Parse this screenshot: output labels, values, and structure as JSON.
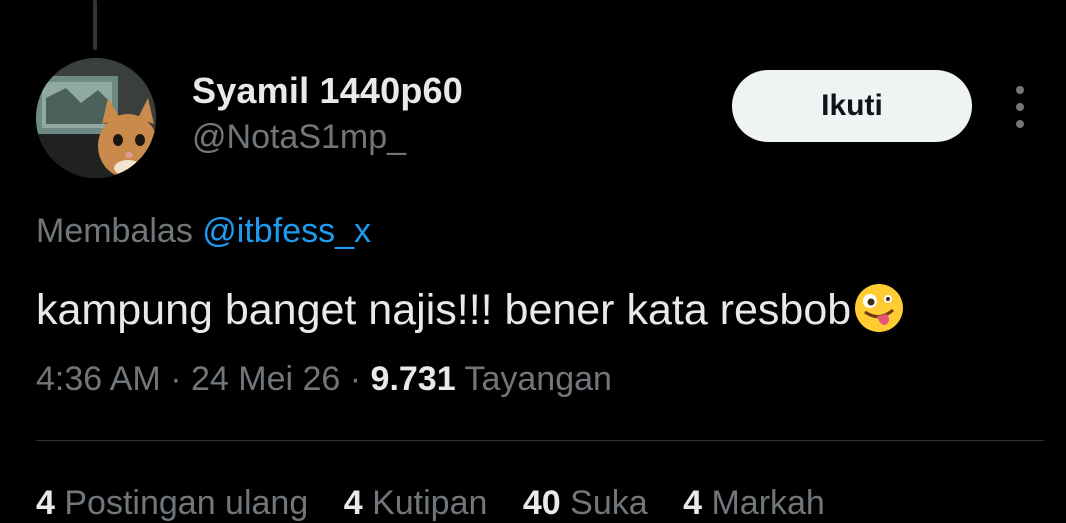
{
  "author": {
    "name": "Syamil 1440p60",
    "handle": "@NotaS1mp_"
  },
  "follow_label": "Ikuti",
  "reply": {
    "prefix": "Membalas",
    "mention": "@itbfess_x"
  },
  "tweet": {
    "text": "kampung banget najis!!! bener kata resbob",
    "emoji": "zany-face-emoji"
  },
  "meta": {
    "time": "4:36 AM",
    "sep1": "·",
    "date": "24 Mei 26",
    "sep2": "·",
    "views": "9.731",
    "views_label": "Tayangan"
  },
  "stats": [
    {
      "count": "4",
      "label": "Postingan ulang"
    },
    {
      "count": "4",
      "label": "Kutipan"
    },
    {
      "count": "40",
      "label": "Suka"
    },
    {
      "count": "4",
      "label": "Markah"
    }
  ],
  "colors": {
    "background": "#000000",
    "text": "#e7e9ea",
    "muted": "#71767b",
    "link": "#1d9bf0",
    "button_bg": "#eff3f4"
  }
}
